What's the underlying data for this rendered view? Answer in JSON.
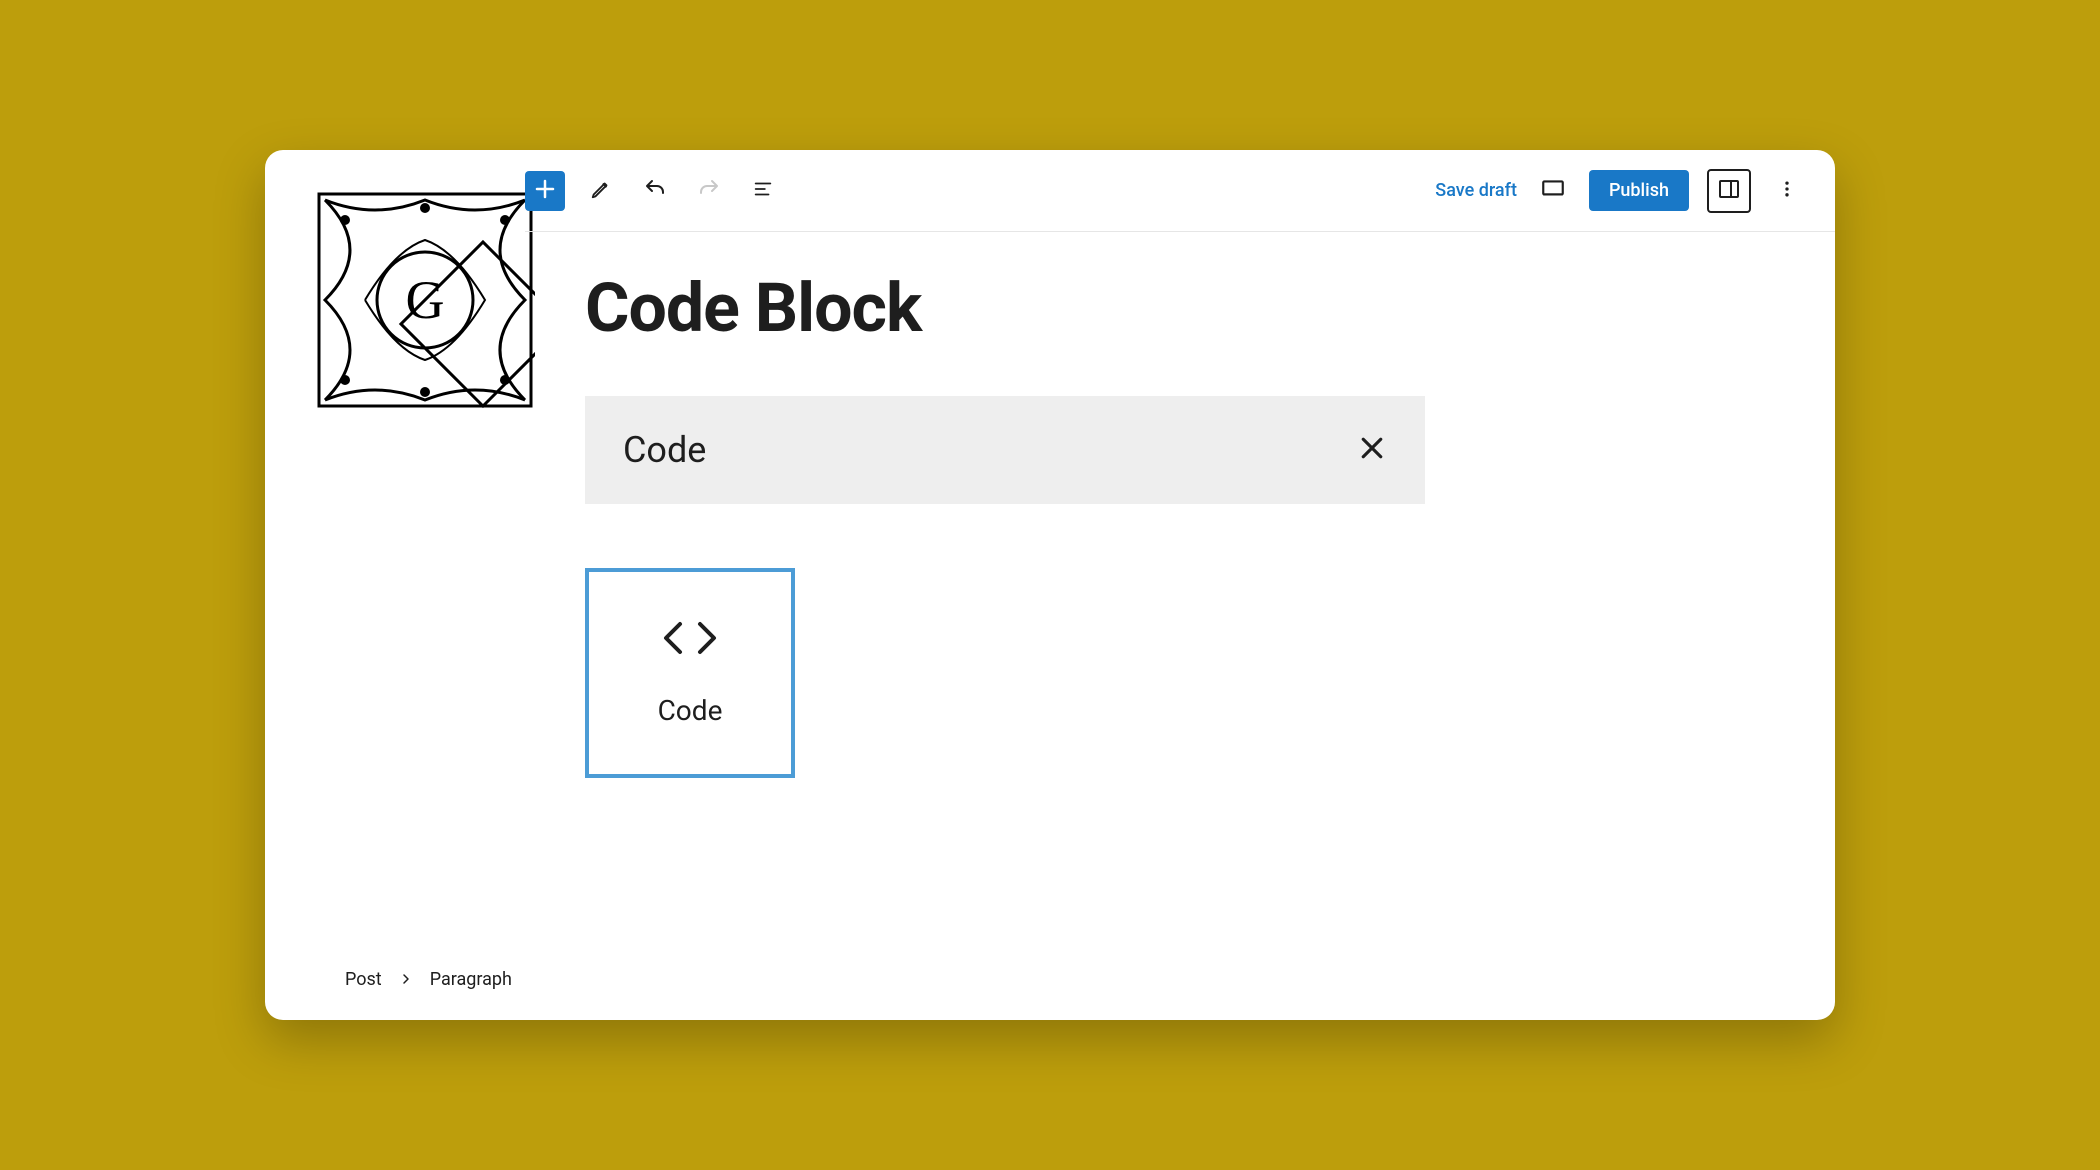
{
  "toolbar": {
    "save_draft": "Save draft",
    "publish": "Publish"
  },
  "post": {
    "title": "Code Block"
  },
  "inserter": {
    "search_value": "Code",
    "result_label": "Code"
  },
  "breadcrumb": {
    "root": "Post",
    "current": "Paragraph"
  }
}
